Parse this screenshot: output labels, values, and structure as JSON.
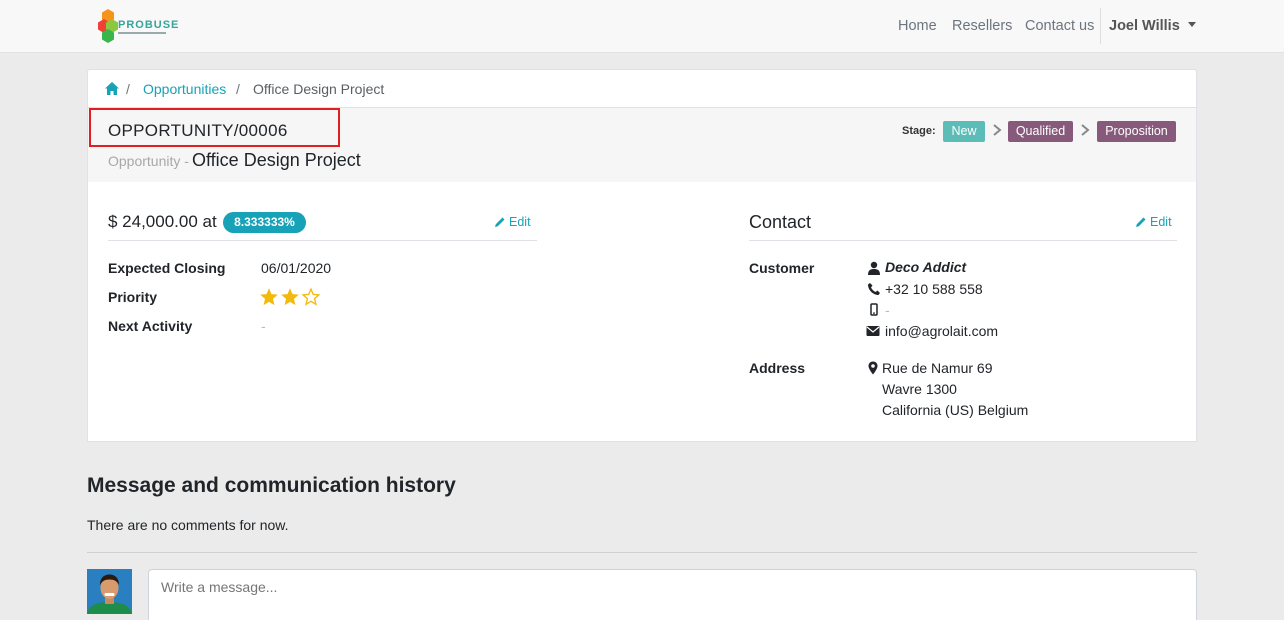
{
  "brand": {
    "name": "PROBUSE",
    "tagline": "PROBUSE SOFTWARE"
  },
  "nav": {
    "items": [
      "Home",
      "Resellers",
      "Contact us"
    ],
    "user": "Joel Willis"
  },
  "breadcrumb": {
    "sep": "/",
    "link": "Opportunities",
    "current": "Office Design Project"
  },
  "header": {
    "reference": "OPPORTUNITY/00006",
    "type_label": "Opportunity -",
    "name": "Office Design Project",
    "stage_label": "Stage:",
    "stages": [
      {
        "label": "New",
        "color": "#5cbcb7"
      },
      {
        "label": "Qualified",
        "color": "#875a7b"
      },
      {
        "label": "Proposition",
        "color": "#875a7b"
      }
    ]
  },
  "details": {
    "amount_text": "$ 24,000.00 at",
    "probability": "8.333333%",
    "edit_label": "Edit",
    "expected_closing_label": "Expected Closing",
    "expected_closing": "06/01/2020",
    "priority_label": "Priority",
    "priority_rating": 2,
    "priority_max": 3,
    "next_activity_label": "Next Activity",
    "next_activity": "-"
  },
  "contact": {
    "title": "Contact",
    "edit_label": "Edit",
    "customer_label": "Customer",
    "customer_name": "Deco Addict",
    "phone": "+32 10 588 558",
    "mobile": "-",
    "email": "info@agrolait.com",
    "address_label": "Address",
    "address_line1": "Rue de Namur 69",
    "address_line2": "Wavre 1300",
    "address_line3": "California (US) Belgium"
  },
  "messages": {
    "title": "Message and communication history",
    "empty": "There are no comments for now.",
    "placeholder": "Write a message..."
  },
  "colors": {
    "accent": "#17a2b8",
    "stage_purple": "#875a7b",
    "stage_new": "#5cbcb7",
    "star": "#f3b90c",
    "highlight_box": "#e02020"
  }
}
